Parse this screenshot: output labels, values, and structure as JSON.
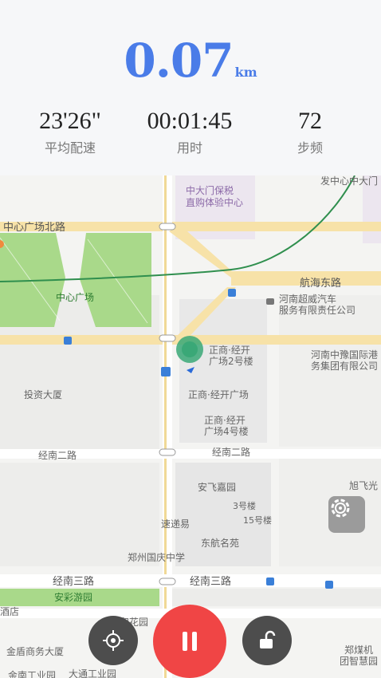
{
  "header": {
    "distance_value": "0.07",
    "distance_unit": "km",
    "metrics": [
      {
        "value": "23'26\"",
        "label": "平均配速"
      },
      {
        "value": "00:01:45",
        "label": "用时"
      },
      {
        "value": "72",
        "label": "步频"
      }
    ]
  },
  "map": {
    "labels": {
      "baoshui": "中大门保税\n直购体验中心",
      "fazhan": "发中心中大门",
      "zhongxin_north": "中心广场北路",
      "hanghai": "航海东路",
      "zhongxin_plaza": "中心广场",
      "henan_auto": "河南超威汽车\n服务有限责任公司",
      "zhengshang2": "正商·经开\n广场2号楼",
      "henan_port": "河南中豫国际港\n务集团有限公司",
      "touzi": "投资大厦",
      "zhengshang": "正商·经开广场",
      "zhengshang4": "正商·经开\n广场4号楼",
      "jingnan2_left": "经南二路",
      "jingnan2_right": "经南二路",
      "anfei": "安飞嘉园",
      "xufei": "旭飞光",
      "building3": "3号楼",
      "building15": "15号楼",
      "sudiyi": "速递易",
      "donghang": "东航名苑",
      "guoqing": "郑州国庆中学",
      "jingnan3_left": "经南三路",
      "jingnan3_right": "经南三路",
      "ancai": "安彩游园",
      "jiudian": "酒店",
      "wanhe": "万和花园",
      "jindun": "金盾商务大厦",
      "jinnan_industry": "金南工业园",
      "datong": "大通工业园",
      "zhengmei": "郑煤机",
      "tuanzhi": "团智慧园"
    }
  },
  "controls": {
    "locate_icon": "crosshair-icon",
    "pause_icon": "pause-icon",
    "lock_icon": "unlock-icon",
    "settings_icon": "gear-icon"
  },
  "colors": {
    "accent": "#4a7ce8",
    "pause": "#f04545",
    "location_dot": "#3aa877",
    "route_line": "#2f8f4e"
  }
}
